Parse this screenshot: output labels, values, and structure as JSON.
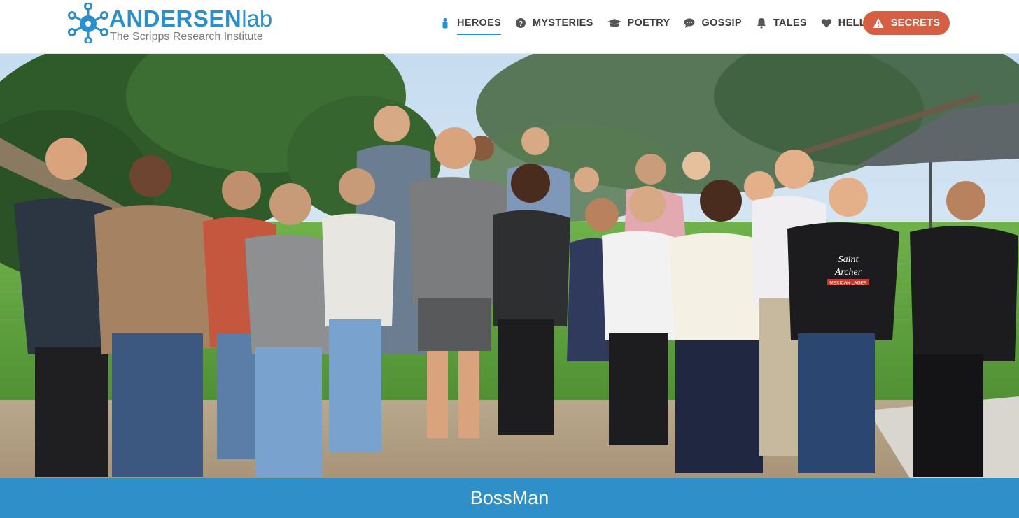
{
  "brand": {
    "name_bold": "ANDERSEN",
    "name_light": "lab",
    "subtitle": "The Scripps Research Institute",
    "color": "#2a8fcb"
  },
  "nav": {
    "items": [
      {
        "label": "HEROES",
        "icon": "person-icon",
        "active": true
      },
      {
        "label": "MYSTERIES",
        "icon": "question-circle-icon",
        "active": false
      },
      {
        "label": "POETRY",
        "icon": "graduation-cap-icon",
        "active": false
      },
      {
        "label": "GOSSIP",
        "icon": "speech-bubble-icon",
        "active": false
      },
      {
        "label": "TALES",
        "icon": "bell-icon",
        "active": false
      },
      {
        "label": "HELLO",
        "icon": "heart-icon",
        "active": false
      }
    ],
    "cta": {
      "label": "SECRETS",
      "icon": "warning-triangle-icon",
      "color": "#d65f43"
    }
  },
  "hero": {
    "image_alt": "Group photo of lab members outdoors",
    "caption": "BossMan",
    "caption_bar_color": "#2f90c9"
  },
  "badges": {
    "shirt_text_1": "Saint",
    "shirt_text_2": "Archer",
    "shirt_text_3": "MEXICAN LAGER"
  }
}
